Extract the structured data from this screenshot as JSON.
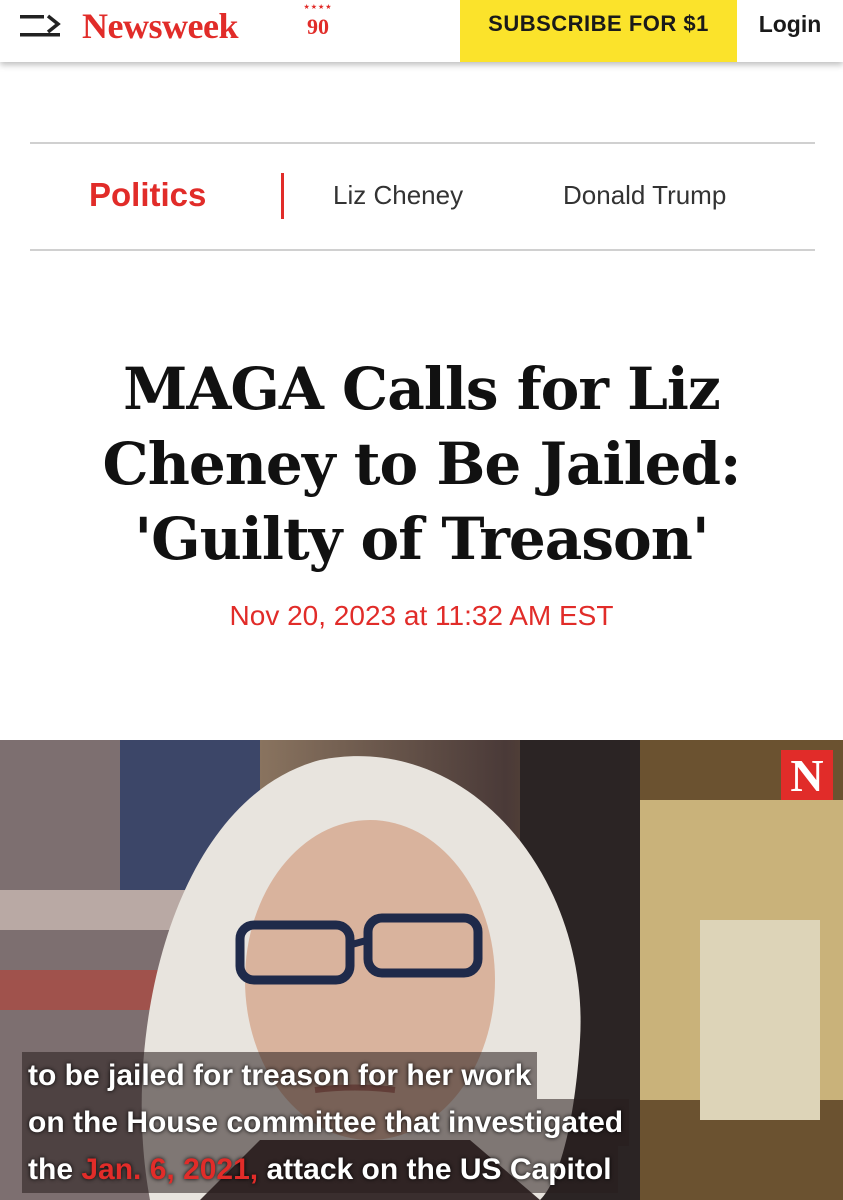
{
  "header": {
    "logo": "Newsweek",
    "logo_badge": "90",
    "subscribe_label": "SUBSCRIBE FOR $1",
    "login_label": "Login"
  },
  "tags": {
    "primary": "Politics",
    "secondary": [
      "Liz Cheney",
      "Donald Trump"
    ]
  },
  "article": {
    "headline": "MAGA Calls for Liz Cheney to Be Jailed: 'Guilty of Treason'",
    "dateline": "Nov 20, 2023 at 11:32 AM EST"
  },
  "hero": {
    "badge": "N",
    "caption": {
      "line1": "to be jailed for treason for her work",
      "line2": "on the House committee that investigated",
      "line3_pre": "the",
      "line3_highlight": "Jan. 6, 2021,",
      "line3_post": "attack on the US Capitol"
    }
  },
  "colors": {
    "brand_red": "#e12c29",
    "subscribe_yellow": "#fbe32b"
  },
  "icons": {
    "menu": "menu-arrow-icon",
    "logo_stars": "stars-icon"
  }
}
